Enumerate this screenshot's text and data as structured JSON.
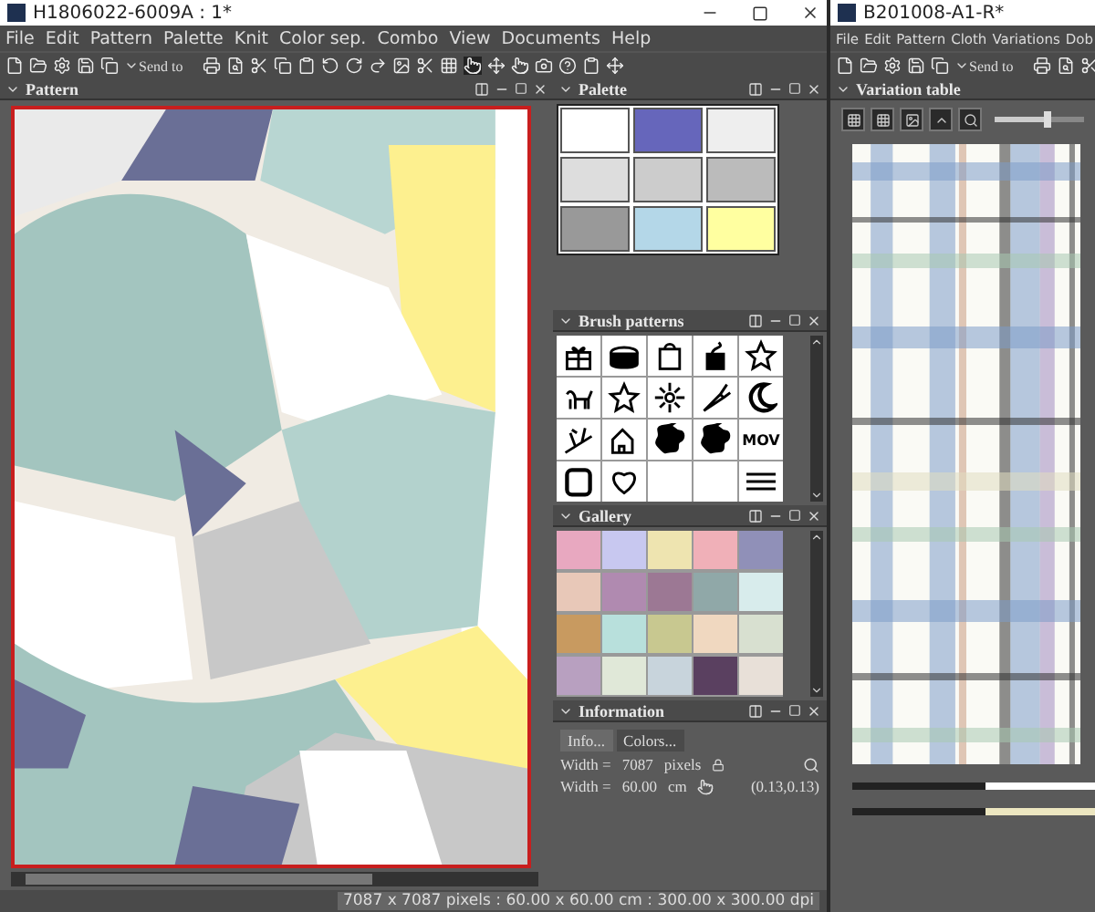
{
  "left_window": {
    "title": "H1806022-6009A : 1*",
    "menu": [
      "File",
      "Edit",
      "Pattern",
      "Palette",
      "Knit",
      "Color sep.",
      "Combo",
      "View",
      "Documents",
      "Help"
    ],
    "send_to": "Send to",
    "pattern_panel": {
      "title": "Pattern"
    },
    "palette_panel": {
      "title": "Palette",
      "swatches": [
        {
          "color": "#ffffff"
        },
        {
          "color": "#6666bb"
        },
        {
          "color": "#eeeeee"
        },
        {
          "color": "#dddddd"
        },
        {
          "color": "#cccccc"
        },
        {
          "color": "#bbbbbb"
        },
        {
          "color": "#999999"
        },
        {
          "color": "#b4d7e8"
        },
        {
          "color": "#ffffa0"
        }
      ]
    },
    "brush_panel": {
      "title": "Brush patterns",
      "tiles": [
        {
          "kind": "gift"
        },
        {
          "kind": "cake"
        },
        {
          "kind": "bag"
        },
        {
          "kind": "cup"
        },
        {
          "kind": "star"
        },
        {
          "kind": "dog"
        },
        {
          "kind": "star"
        },
        {
          "kind": "sun"
        },
        {
          "kind": "carrot"
        },
        {
          "kind": "moon"
        },
        {
          "kind": "tree"
        },
        {
          "kind": "house"
        },
        {
          "kind": "blob"
        },
        {
          "kind": "blob"
        },
        {
          "kind": "word",
          "text": "MOV"
        },
        {
          "kind": "frame"
        },
        {
          "kind": "heart"
        },
        {
          "kind": "empty"
        },
        {
          "kind": "empty"
        },
        {
          "kind": "lines"
        }
      ]
    },
    "gallery_panel": {
      "title": "Gallery",
      "thumbnails": [
        {
          "color": "#e8a8c0"
        },
        {
          "color": "#c8c8f0"
        },
        {
          "color": "#eee4b0"
        },
        {
          "color": "#f0b0b8"
        },
        {
          "color": "#9090b8"
        },
        {
          "color": "#e8c8b8"
        },
        {
          "color": "#b08ab0"
        },
        {
          "color": "#9c7894"
        },
        {
          "color": "#90a8a8"
        },
        {
          "color": "#d8ecec"
        },
        {
          "color": "#c89a60"
        },
        {
          "color": "#b8e0dc"
        },
        {
          "color": "#c8c890"
        },
        {
          "color": "#f0d8c0"
        },
        {
          "color": "#d8e0d0"
        },
        {
          "color": "#b8a0c0"
        },
        {
          "color": "#e0e8d8"
        },
        {
          "color": "#c8d4dc"
        },
        {
          "color": "#5a4060"
        },
        {
          "color": "#e8e0d8"
        }
      ]
    },
    "info_panel": {
      "title": "Information",
      "tabs": [
        {
          "label": "Info...",
          "selected": true
        },
        {
          "label": "Colors...",
          "selected": false
        }
      ],
      "rows": [
        {
          "label": "Width =",
          "value": "7087",
          "unit": "pixels"
        },
        {
          "label": "Width =",
          "value": "60.00",
          "unit": "cm"
        }
      ],
      "coords": "(0.13,0.13)"
    },
    "status_bar": "7087 x 7087 pixels : 60.00 x 60.00 cm : 300.00 x 300.00 dpi"
  },
  "right_window": {
    "title": "B201008-A1-R*",
    "menu": [
      "File",
      "Edit",
      "Pattern",
      "Cloth",
      "Variations",
      "Dob"
    ],
    "send_to": "Send to",
    "panel": {
      "title": "Variation table"
    },
    "zoom_slider": {
      "level": 0.6
    }
  }
}
